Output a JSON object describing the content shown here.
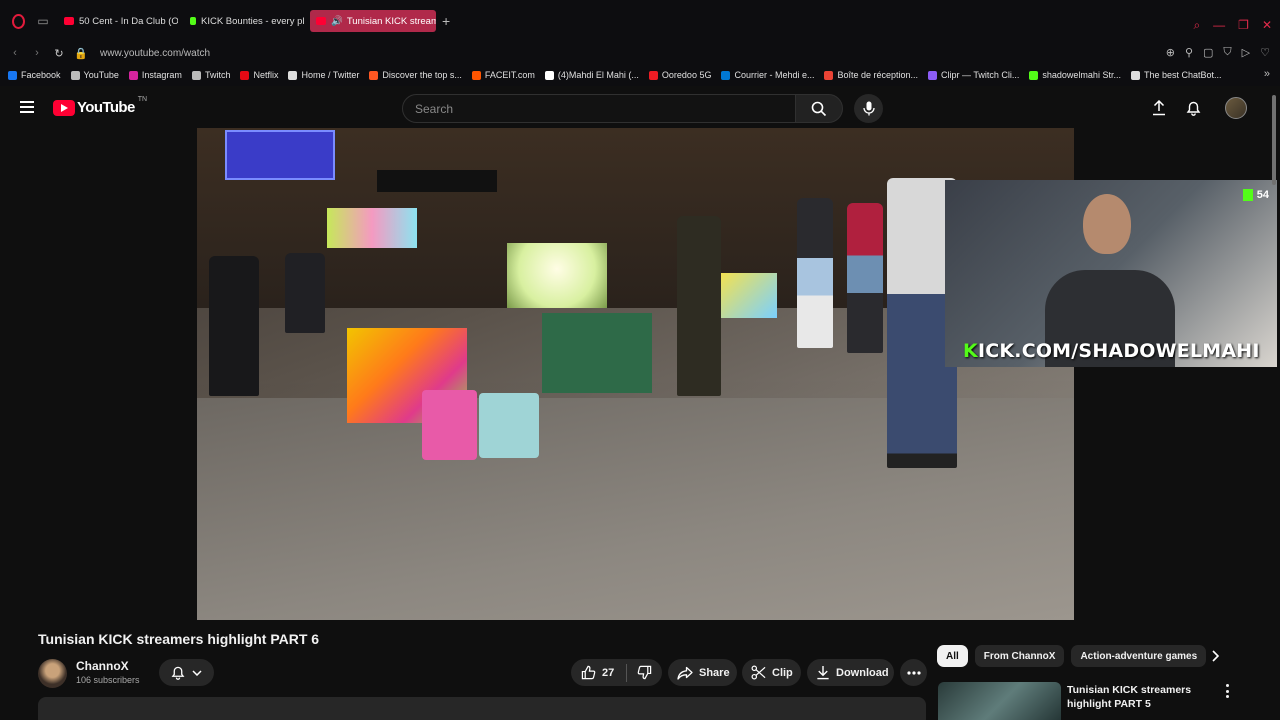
{
  "browser": {
    "tabs": [
      {
        "label": "50 Cent - In Da Club (Offic",
        "favicon": "youtube-favicon"
      },
      {
        "label": "KICK Bounties - every pla",
        "favicon": "kick-favicon"
      },
      {
        "label": "Tunisian KICK streame",
        "favicon": "youtube-favicon",
        "active": true
      }
    ],
    "url": "www.youtube.com/watch",
    "bookmarks": [
      {
        "label": "Facebook",
        "color": "#1877f2"
      },
      {
        "label": "YouTube",
        "color": "#bbbbbb"
      },
      {
        "label": "Instagram",
        "color": "#d6249f"
      },
      {
        "label": "Twitch",
        "color": "#bbbbbb"
      },
      {
        "label": "Netflix",
        "color": "#e50914"
      },
      {
        "label": "Home / Twitter",
        "color": "#dddddd"
      },
      {
        "label": "Discover the top s...",
        "color": "#ff5722"
      },
      {
        "label": "FACEIT.com",
        "color": "#ff5500"
      },
      {
        "label": "(4)Mahdi El Mahi (...",
        "color": "#ffffff"
      },
      {
        "label": "Ooredoo 5G",
        "color": "#ed1c24"
      },
      {
        "label": "Courrier - Mehdi e...",
        "color": "#0078d4"
      },
      {
        "label": "Boîte de réception...",
        "color": "#ea4335"
      },
      {
        "label": "Clipr — Twitch Cli...",
        "color": "#8c5cf6"
      },
      {
        "label": "shadowelmahi Str...",
        "color": "#53fc18"
      },
      {
        "label": "The best ChatBot...",
        "color": "#dddddd"
      }
    ]
  },
  "youtube": {
    "logo_text": "YouTube",
    "logo_country": "TN",
    "search_placeholder": "Search"
  },
  "player": {
    "overlay_badge_count": "54",
    "overlay_url_prefix": "K",
    "overlay_url_rest": "ICK.COM/SHADOWELMAHI"
  },
  "video": {
    "title": "Tunisian KICK streamers highlight PART 6",
    "channel_name": "ChannoX",
    "subscribers": "106 subscribers",
    "like_count": "27",
    "share_label": "Share",
    "clip_label": "Clip",
    "download_label": "Download"
  },
  "sidebar": {
    "chips": [
      "All",
      "From ChannoX",
      "Action-adventure games"
    ],
    "recommendation_title": "Tunisian KICK streamers highlight PART 5"
  },
  "colors": {
    "youtube_red": "#ff0033",
    "kick_green": "#53fc18",
    "active_tab": "#b0294a",
    "opera_red": "#e21b3c"
  }
}
